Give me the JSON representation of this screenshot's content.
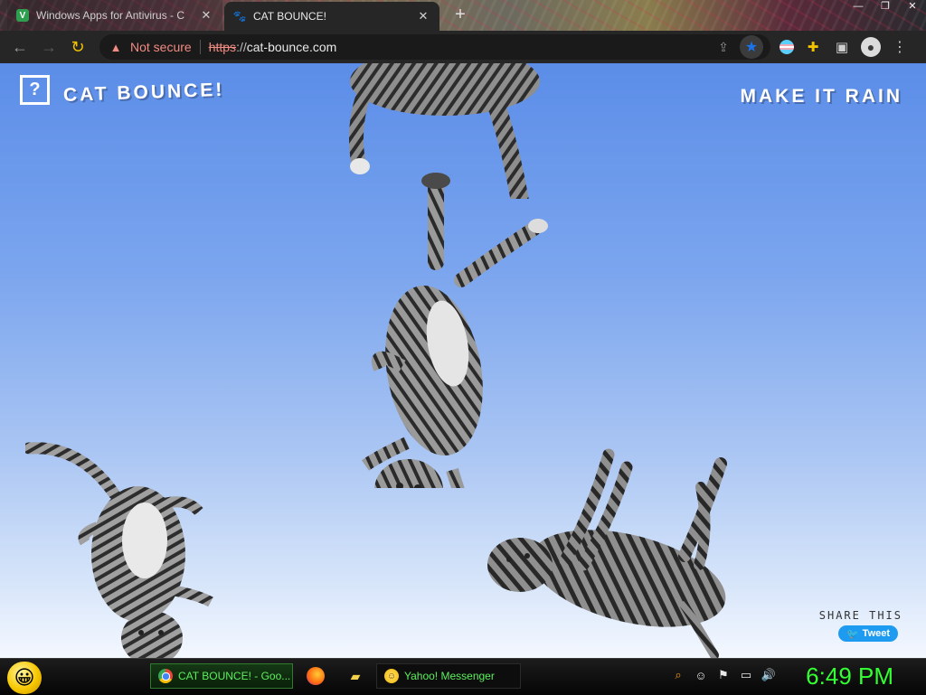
{
  "tabs": [
    {
      "title": "Windows Apps for Antivirus - C",
      "favicon": "V",
      "active": false
    },
    {
      "title": "CAT BOUNCE!",
      "favicon": "cat",
      "active": true
    }
  ],
  "new_tab_label": "+",
  "toolbar": {
    "security_label": "Not secure",
    "url_scheme": "https",
    "url_rest": "://",
    "url_host": "cat-bounce.com"
  },
  "page": {
    "help_label": "?",
    "logo_text": "CAT BOUNCE!",
    "make_it_rain_label": "MAKE IT RAIN",
    "share_label": "SHARE THIS",
    "tweet_label": "Tweet"
  },
  "taskbar": {
    "items": [
      {
        "label": "CAT BOUNCE! - Goo...",
        "app": "chrome"
      },
      {
        "label": "Yahoo! Messenger",
        "app": "yahoo"
      }
    ],
    "clock": "6:49 PM"
  },
  "colors": {
    "sky_top": "#5b8de8",
    "sky_bottom": "#f4f8ff",
    "not_secure": "#f28b82",
    "taskbar_text": "#5cf05c",
    "clock": "#33ff33",
    "tweet_blue": "#1d9bf0"
  }
}
